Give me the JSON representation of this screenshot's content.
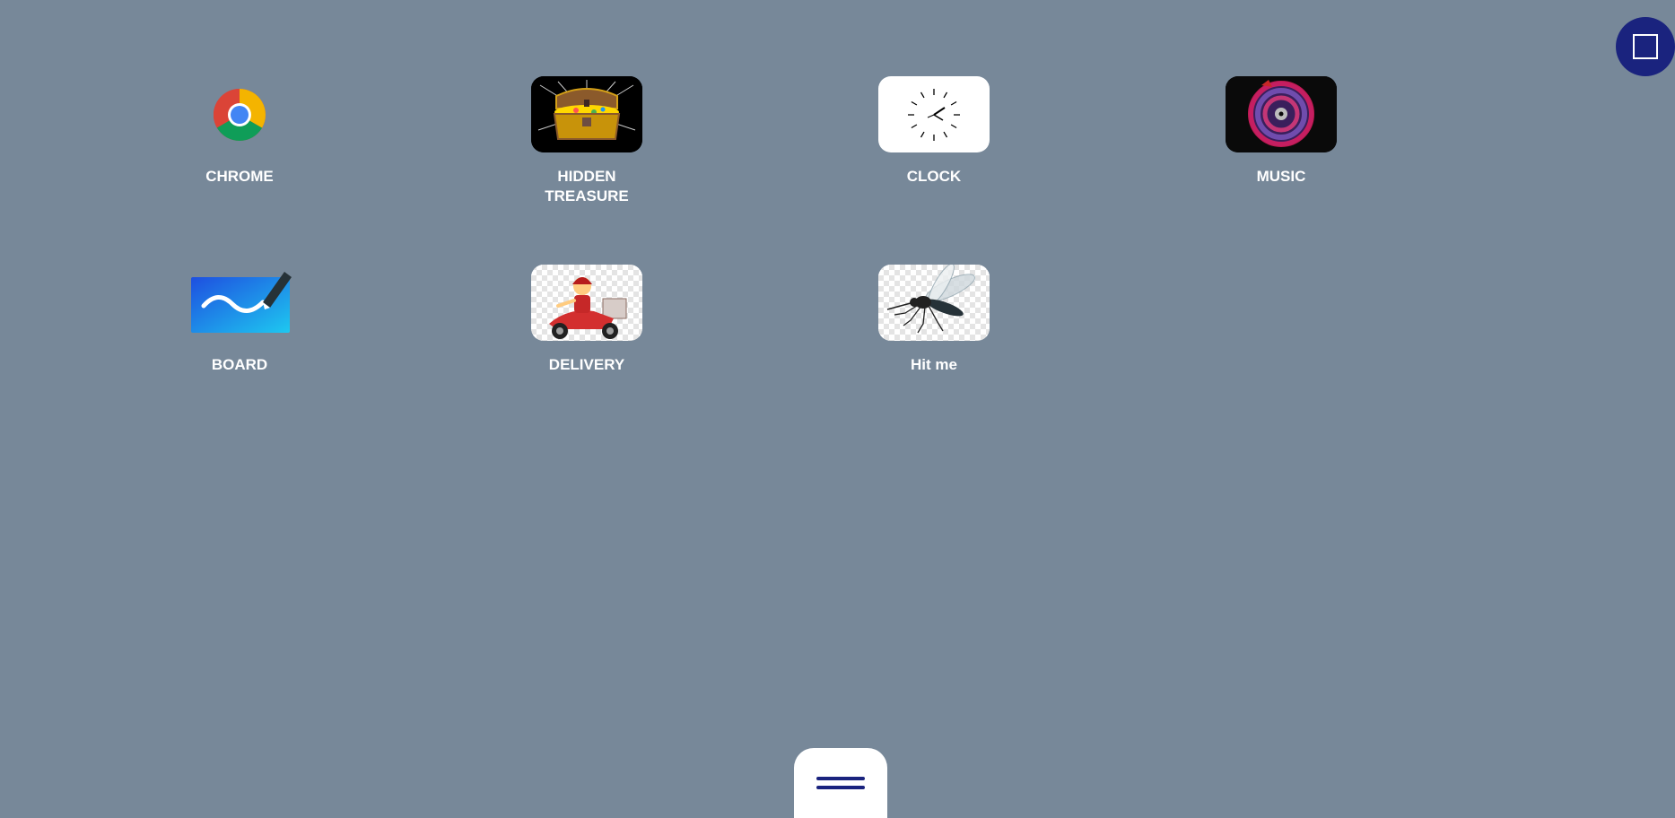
{
  "desktop": {
    "background": "#778899",
    "apps": [
      {
        "label": "CHROME",
        "icon": "chrome-icon"
      },
      {
        "label": "HIDDEN TREASURE",
        "icon": "treasure-chest-icon"
      },
      {
        "label": "CLOCK",
        "icon": "clock-icon"
      },
      {
        "label": "MUSIC",
        "icon": "music-disc-icon"
      },
      {
        "label": "BOARD",
        "icon": "whiteboard-icon"
      },
      {
        "label": "DELIVERY",
        "icon": "delivery-scooter-icon"
      },
      {
        "label": "Hit me",
        "icon": "mosquito-icon"
      }
    ]
  },
  "corner_button": {
    "icon": "square-icon",
    "color": "#1a237e"
  },
  "menu_button": {
    "icon": "hamburger-menu-icon",
    "color": "#1a237e"
  }
}
